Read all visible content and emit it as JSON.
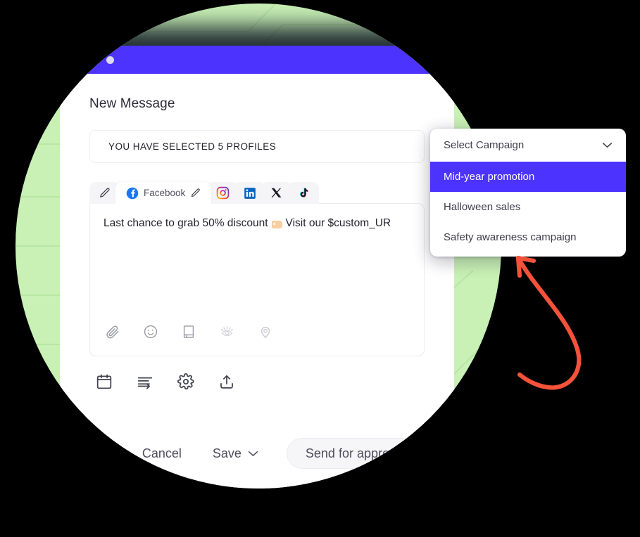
{
  "window": {
    "title_dots": 3,
    "accent_color": "#4c33fd"
  },
  "page": {
    "title": "New Message"
  },
  "profiles": {
    "summary_text": "YOU HAVE SELECTED 5 PROFILES",
    "count": 5
  },
  "campaign_dropdown": {
    "placeholder": "Select Campaign",
    "chevron_icon": "chevron-down-icon",
    "options": [
      {
        "label": "Mid-year promotion",
        "selected": true
      },
      {
        "label": "Halloween sales",
        "selected": false
      },
      {
        "label": "Safety awareness campaign",
        "selected": false
      }
    ],
    "highlight_color": "#4c33fd"
  },
  "editor": {
    "tabs": [
      {
        "id": "compose",
        "label": "",
        "icon": "pencil-icon",
        "active": false
      },
      {
        "id": "facebook",
        "label": "Facebook",
        "icon": "facebook-icon",
        "trailing_icon": "pencil-icon",
        "active": true
      },
      {
        "id": "instagram",
        "label": "",
        "icon": "instagram-icon",
        "active": false
      },
      {
        "id": "linkedin",
        "label": "",
        "icon": "linkedin-icon",
        "active": false
      },
      {
        "id": "x",
        "label": "",
        "icon": "x-twitter-icon",
        "active": false
      },
      {
        "id": "tiktok",
        "label": "",
        "icon": "tiktok-icon",
        "active": false
      }
    ],
    "message_before_emoji": "Last chance to grab 50% discount",
    "message_after_emoji": "Visit our $custom_UR",
    "emoji_name": "label-tag-emoji",
    "toolbar_icons": [
      "attachment-icon",
      "emoji-icon",
      "saved-replies-icon",
      "preview-icon",
      "location-icon"
    ]
  },
  "sub_toolbar": {
    "icons": [
      "calendar-icon",
      "queue-icon",
      "settings-gear-icon",
      "share-upload-icon"
    ]
  },
  "footer": {
    "cancel_label": "Cancel",
    "save_label": "Save",
    "save_chevron_icon": "chevron-down-icon",
    "send_label": "Send for approval"
  },
  "annotation": {
    "arrow_color": "#f5523a",
    "arrow_name": "red-curved-arrow"
  },
  "decor": {
    "circle_color": "#c9f1b6",
    "background_color": "#000000"
  }
}
